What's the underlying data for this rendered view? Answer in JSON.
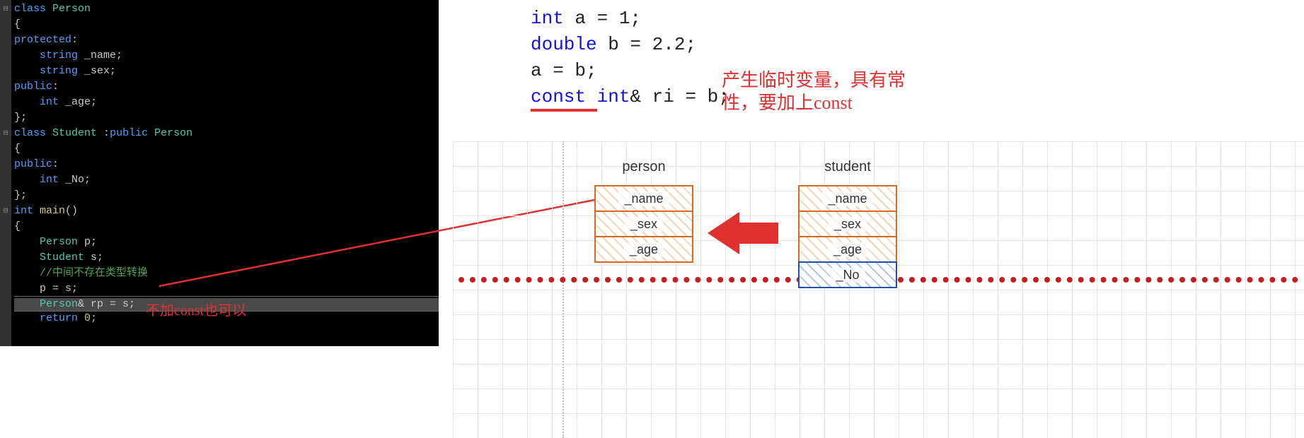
{
  "editor": {
    "lines": {
      "l1_kw_class": "class",
      "l1_name": "Person",
      "l2": "{",
      "l3_kw": "protected",
      "l3_colon": ":",
      "l4_type": "string",
      "l4_name": "_name;",
      "l5_type": "string",
      "l5_name": "_sex;",
      "l6_kw": "public",
      "l6_colon": ":",
      "l7_type": "int",
      "l7_name": "_age;",
      "l8": "};",
      "l9_kw_class": "class",
      "l9_name": "Student",
      "l9_colon": " :",
      "l9_pub": "public",
      "l9_base": "Person",
      "l10": "{",
      "l11_kw": "public",
      "l11_colon": ":",
      "l12_type": "int",
      "l12_name": "_No;",
      "l13": "};",
      "l14_type": "int",
      "l14_fn": "main",
      "l14_paren": "()",
      "l15": "{",
      "l16_type": "Person",
      "l16_var": "p;",
      "l17_type": "Student",
      "l17_var": "s;",
      "l18_comment": "//中间不存在类型转换",
      "l19": "p = s;",
      "l20_type": "Person",
      "l20_rest": "& rp = s;",
      "l21_kw": "return",
      "l21_rest": " 0;"
    },
    "folds": [
      "⊟",
      "",
      "",
      "",
      "",
      "",
      "",
      "",
      "⊟",
      "",
      "",
      "",
      "",
      "⊟",
      "",
      "",
      "",
      "",
      "",
      "",
      ""
    ],
    "overlay": "不加const也可以"
  },
  "snippet": {
    "l1_kw": "int",
    "l1_rest": " a = 1;",
    "l2_kw": "double",
    "l2_rest": " b = 2.2;",
    "l3": "a = b;",
    "l4_const": "const ",
    "l4_kw": "int",
    "l4_rest": "& ri = b;"
  },
  "annotation": {
    "line1": "产生临时变量，具有常",
    "line2": "性，要加上const"
  },
  "diagram": {
    "person_label": "person",
    "student_label": "student",
    "cells": {
      "name": "_name",
      "sex": "_sex",
      "age": "_age",
      "no": "_No"
    }
  }
}
